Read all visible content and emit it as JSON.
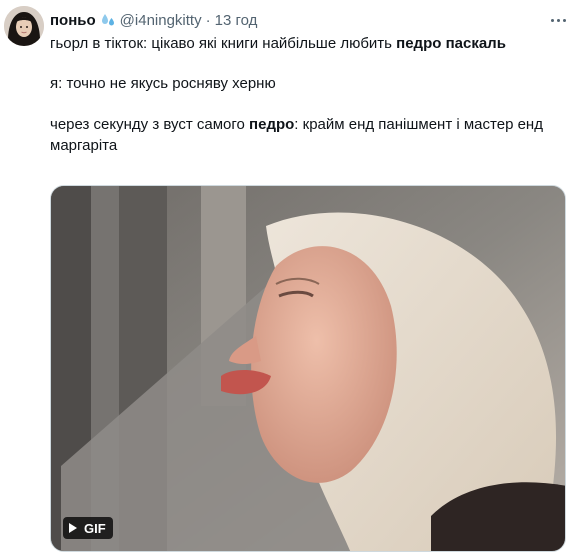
{
  "tweet": {
    "author_name": "поньо",
    "handle": "@i4ningkitty",
    "separator": "·",
    "time": "13 год",
    "text1_prefix": "гьорл в тікток: цікаво які книги найбільше любить ",
    "text1_bold": "педро паскаль",
    "text2": "я: точно не якусь росняву херню",
    "text3_prefix": "через секунду з вуст самого ",
    "text3_bold": "педро",
    "text3_suffix": ": крайм енд панішмент і мастер енд маргаріта",
    "media": {
      "badge": "GIF"
    }
  },
  "icons": {
    "badge": "water-droplets-icon",
    "more": "more-dots-icon",
    "play": "play-icon"
  },
  "colors": {
    "text": "#0f1419",
    "secondary": "#536471",
    "border": "#cfd9de",
    "badge_bg": "#000000"
  }
}
